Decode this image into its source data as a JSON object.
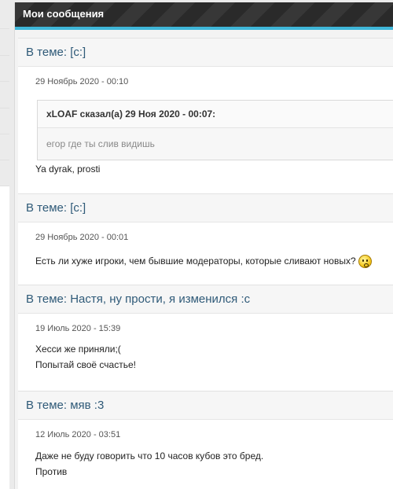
{
  "header": {
    "title": "Мои сообщения"
  },
  "posts": [
    {
      "topic": "В теме: [c:]",
      "date": "29 Ноябрь 2020 - 00:10",
      "quote_author": "xLOAF сказал(а) 29 Ноя 2020 - 00:07:",
      "quote_text": "егор где ты слив видишь",
      "text": "Ya dyrak, prosti"
    },
    {
      "topic": "В теме: [c:]",
      "date": "29 Ноябрь 2020 - 00:01",
      "text": "Есть ли хуже игроки, чем бывшие модераторы, которые сливают новых?",
      "icon": "confused-smiley-icon"
    },
    {
      "topic": "В теме: Настя, ну прости, я изменился :с",
      "date": "19 Июль 2020 - 15:39",
      "lines": [
        "Хесси же приняли;(",
        "Попытай своё счастье!"
      ]
    },
    {
      "topic": "В теме: мяв :3",
      "date": "12 Июль 2020 - 03:51",
      "lines": [
        "Даже не буду говорить что 10 часов кубов это бред.",
        "Против"
      ]
    }
  ]
}
